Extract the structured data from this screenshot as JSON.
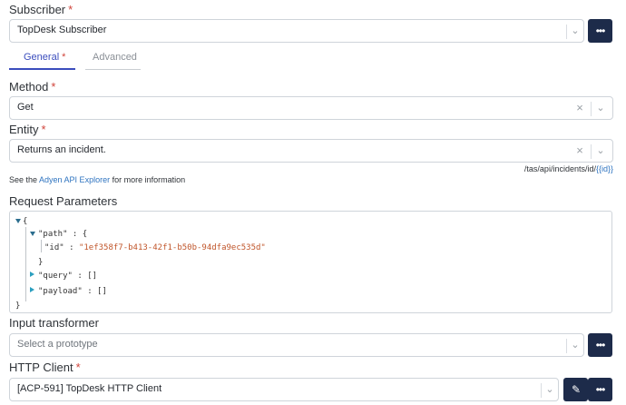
{
  "subscriber": {
    "label": "Subscriber",
    "required": "*",
    "value": "TopDesk Subscriber"
  },
  "tabs": [
    {
      "label": "General",
      "required": "*",
      "active": true
    },
    {
      "label": "Advanced",
      "active": false
    }
  ],
  "method": {
    "label": "Method",
    "required": "*",
    "value": "Get"
  },
  "entity": {
    "label": "Entity",
    "required": "*",
    "value": "Returns an incident."
  },
  "endpoint": {
    "prefix": "/tas/api/incidents/id/",
    "param": "{{id}}"
  },
  "info": {
    "prefix": "See the ",
    "link": "Adyen API Explorer",
    "suffix": " for more information"
  },
  "request_params": {
    "label": "Request Parameters",
    "open_brace": "{",
    "path_key": "\"path\"",
    "colon": " : ",
    "path_open": "{",
    "id_key": "\"id\"",
    "id_value": "\"1ef358f7-b413-42f1-b50b-94dfa9ec535d\"",
    "path_close": "}",
    "query_key": "\"query\"",
    "query_value": "[]",
    "payload_key": "\"payload\"",
    "payload_value": "[]",
    "close_brace": "}"
  },
  "input_transformer": {
    "label": "Input transformer",
    "placeholder": "Select a prototype"
  },
  "http_client": {
    "label": "HTTP Client",
    "required": "*",
    "value": "[ACP-591] TopDesk HTTP Client"
  },
  "icons": {
    "more": "more-horizontal-icon",
    "edit": "pencil-icon",
    "chevron": "chevron-down-icon",
    "clear": "close-icon"
  },
  "colors": {
    "accent": "#3b4dbd",
    "dark_button": "#1d2b4a",
    "required": "#d0433a",
    "link": "#2f74c0"
  }
}
